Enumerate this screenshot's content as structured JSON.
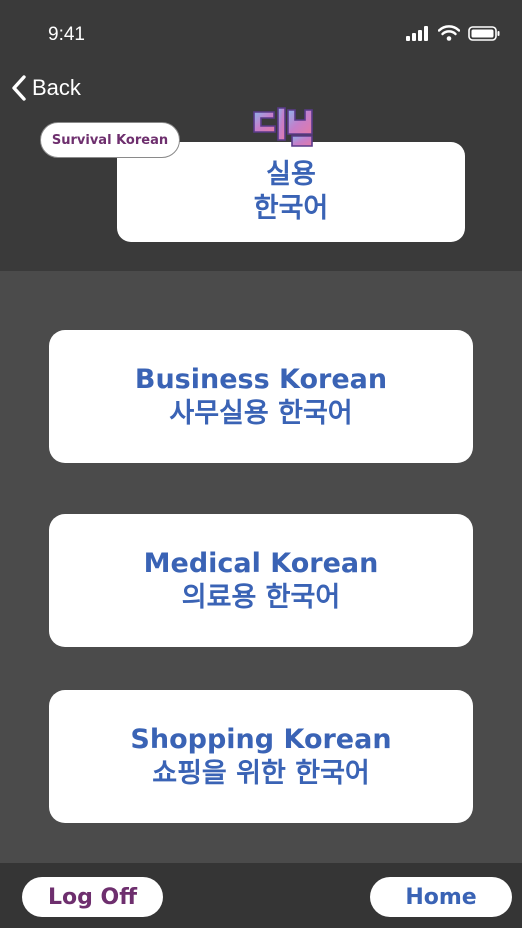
{
  "status_bar": {
    "time": "9:41"
  },
  "nav": {
    "back_label": "Back"
  },
  "header": {
    "badge_label": "Survival Korean",
    "logo_line1": "실용",
    "logo_line2": "한국어"
  },
  "menu": {
    "items": [
      {
        "title": "Business Korean",
        "subtitle": "사무실용 한국어"
      },
      {
        "title": "Medical Korean",
        "subtitle": "의료용 한국어"
      },
      {
        "title": "Shopping Korean",
        "subtitle": "쇼핑을 위한 한국어"
      }
    ]
  },
  "footer": {
    "logoff_label": "Log Off",
    "home_label": "Home"
  },
  "colors": {
    "header_bg": "#3a3a3a",
    "main_bg": "#4b4b4b",
    "footer_bg": "#353535",
    "accent_blue": "#3a63b5",
    "accent_purple": "#6e2f6e"
  }
}
